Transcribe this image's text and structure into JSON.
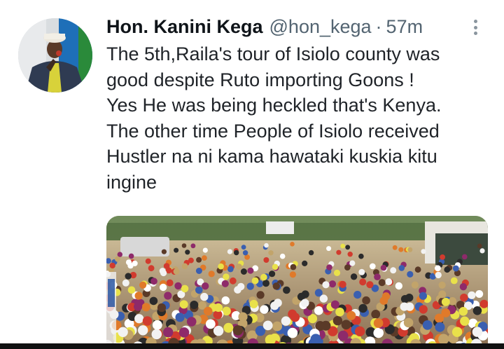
{
  "tweet": {
    "author_name": "Hon. Kanini Kega",
    "handle": "@hon_kega",
    "separator": "·",
    "timestamp": "57m",
    "text_lines": [
      "The 5th,Raila's tour of Isiolo county was",
      "good despite Ruto importing Goons !",
      "Yes He was being heckled that's Kenya.",
      "The other time People of Isiolo received",
      "Hustler na ni kama hawataki kuskia kitu",
      "ingine"
    ],
    "more_icon": "more-vertical-icon"
  },
  "colors": {
    "text_primary": "#0f1419",
    "text_secondary": "#536471",
    "background": "#ffffff"
  }
}
